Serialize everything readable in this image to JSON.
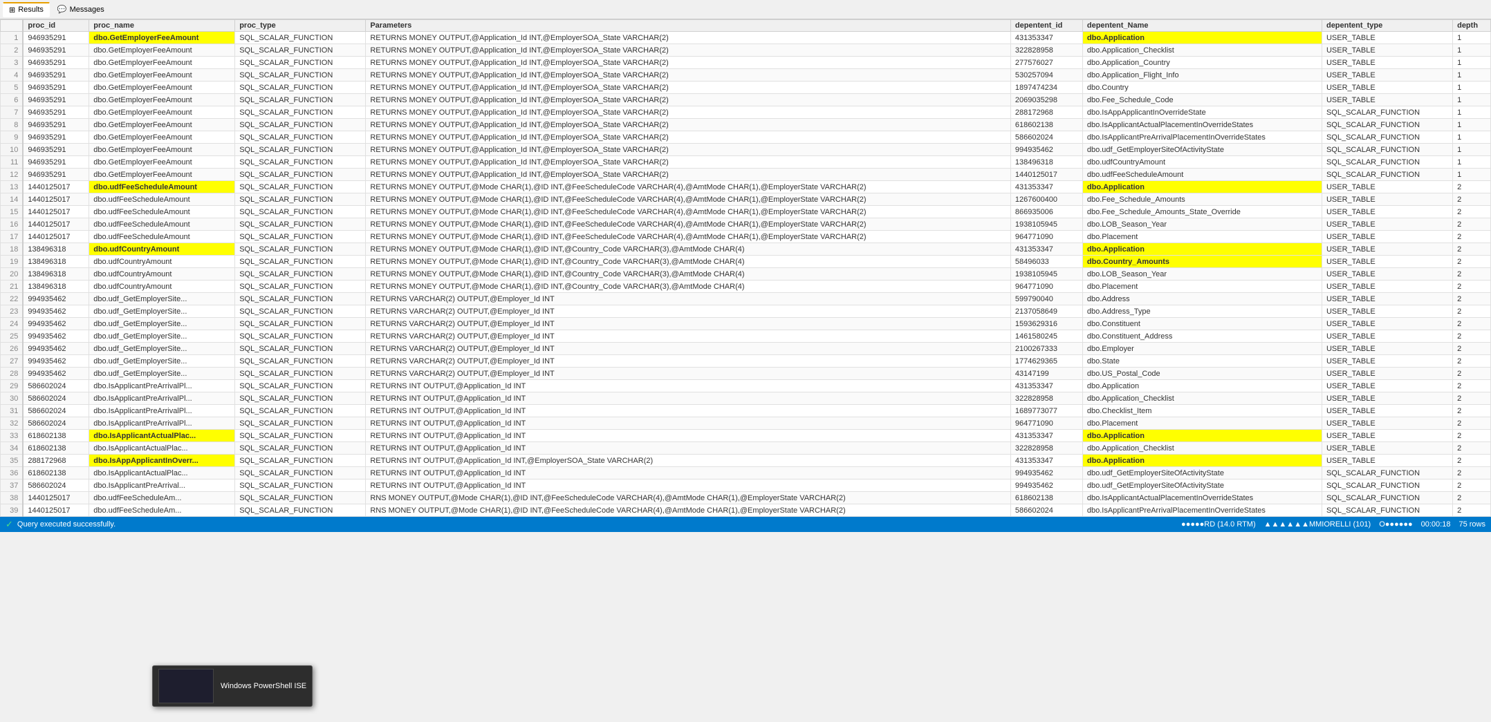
{
  "toolbar": {
    "results_label": "Results",
    "messages_label": "Messages"
  },
  "columns": [
    {
      "id": "rownum",
      "label": ""
    },
    {
      "id": "proc_id",
      "label": "proc_id"
    },
    {
      "id": "proc_name",
      "label": "proc_name"
    },
    {
      "id": "proc_type",
      "label": "proc_type"
    },
    {
      "id": "parameters",
      "label": "Parameters"
    },
    {
      "id": "depentent_id",
      "label": "depentent_id"
    },
    {
      "id": "depentent_Name",
      "label": "depentent_Name"
    },
    {
      "id": "depentent_type",
      "label": "depentent_type"
    },
    {
      "id": "depth",
      "label": "depth"
    }
  ],
  "rows": [
    {
      "rownum": 1,
      "proc_id": "946935291",
      "proc_name": "dbo.GetEmployerFeeAmount",
      "proc_type": "SQL_SCALAR_FUNCTION",
      "parameters": "RETURNS MONEY OUTPUT,@Application_Id INT,@EmployerSOA_State VARCHAR(2)",
      "depentent_id": "431353347",
      "depentent_Name": "dbo.Application",
      "depentent_type": "USER_TABLE",
      "depth": "1",
      "hl_proc": true,
      "hl_dep": true
    },
    {
      "rownum": 2,
      "proc_id": "946935291",
      "proc_name": "dbo.GetEmployerFeeAmount",
      "proc_type": "SQL_SCALAR_FUNCTION",
      "parameters": "RETURNS MONEY OUTPUT,@Application_Id INT,@EmployerSOA_State VARCHAR(2)",
      "depentent_id": "322828958",
      "depentent_Name": "dbo.Application_Checklist",
      "depentent_type": "USER_TABLE",
      "depth": "1"
    },
    {
      "rownum": 3,
      "proc_id": "946935291",
      "proc_name": "dbo.GetEmployerFeeAmount",
      "proc_type": "SQL_SCALAR_FUNCTION",
      "parameters": "RETURNS MONEY OUTPUT,@Application_Id INT,@EmployerSOA_State VARCHAR(2)",
      "depentent_id": "277576027",
      "depentent_Name": "dbo.Application_Country",
      "depentent_type": "USER_TABLE",
      "depth": "1"
    },
    {
      "rownum": 4,
      "proc_id": "946935291",
      "proc_name": "dbo.GetEmployerFeeAmount",
      "proc_type": "SQL_SCALAR_FUNCTION",
      "parameters": "RETURNS MONEY OUTPUT,@Application_Id INT,@EmployerSOA_State VARCHAR(2)",
      "depentent_id": "530257094",
      "depentent_Name": "dbo.Application_Flight_Info",
      "depentent_type": "USER_TABLE",
      "depth": "1"
    },
    {
      "rownum": 5,
      "proc_id": "946935291",
      "proc_name": "dbo.GetEmployerFeeAmount",
      "proc_type": "SQL_SCALAR_FUNCTION",
      "parameters": "RETURNS MONEY OUTPUT,@Application_Id INT,@EmployerSOA_State VARCHAR(2)",
      "depentent_id": "1897474234",
      "depentent_Name": "dbo.Country",
      "depentent_type": "USER_TABLE",
      "depth": "1"
    },
    {
      "rownum": 6,
      "proc_id": "946935291",
      "proc_name": "dbo.GetEmployerFeeAmount",
      "proc_type": "SQL_SCALAR_FUNCTION",
      "parameters": "RETURNS MONEY OUTPUT,@Application_Id INT,@EmployerSOA_State VARCHAR(2)",
      "depentent_id": "2069035298",
      "depentent_Name": "dbo.Fee_Schedule_Code",
      "depentent_type": "USER_TABLE",
      "depth": "1"
    },
    {
      "rownum": 7,
      "proc_id": "946935291",
      "proc_name": "dbo.GetEmployerFeeAmount",
      "proc_type": "SQL_SCALAR_FUNCTION",
      "parameters": "RETURNS MONEY OUTPUT,@Application_Id INT,@EmployerSOA_State VARCHAR(2)",
      "depentent_id": "288172968",
      "depentent_Name": "dbo.IsAppApplicantInOverrideState",
      "depentent_type": "SQL_SCALAR_FUNCTION",
      "depth": "1"
    },
    {
      "rownum": 8,
      "proc_id": "946935291",
      "proc_name": "dbo.GetEmployerFeeAmount",
      "proc_type": "SQL_SCALAR_FUNCTION",
      "parameters": "RETURNS MONEY OUTPUT,@Application_Id INT,@EmployerSOA_State VARCHAR(2)",
      "depentent_id": "618602138",
      "depentent_Name": "dbo.IsApplicantActualPlacementInOverrideStates",
      "depentent_type": "SQL_SCALAR_FUNCTION",
      "depth": "1"
    },
    {
      "rownum": 9,
      "proc_id": "946935291",
      "proc_name": "dbo.GetEmployerFeeAmount",
      "proc_type": "SQL_SCALAR_FUNCTION",
      "parameters": "RETURNS MONEY OUTPUT,@Application_Id INT,@EmployerSOA_State VARCHAR(2)",
      "depentent_id": "586602024",
      "depentent_Name": "dbo.IsApplicantPreArrivalPlacementInOverrideStates",
      "depentent_type": "SQL_SCALAR_FUNCTION",
      "depth": "1"
    },
    {
      "rownum": 10,
      "proc_id": "946935291",
      "proc_name": "dbo.GetEmployerFeeAmount",
      "proc_type": "SQL_SCALAR_FUNCTION",
      "parameters": "RETURNS MONEY OUTPUT,@Application_Id INT,@EmployerSOA_State VARCHAR(2)",
      "depentent_id": "994935462",
      "depentent_Name": "dbo.udf_GetEmployerSiteOfActivityState",
      "depentent_type": "SQL_SCALAR_FUNCTION",
      "depth": "1"
    },
    {
      "rownum": 11,
      "proc_id": "946935291",
      "proc_name": "dbo.GetEmployerFeeAmount",
      "proc_type": "SQL_SCALAR_FUNCTION",
      "parameters": "RETURNS MONEY OUTPUT,@Application_Id INT,@EmployerSOA_State VARCHAR(2)",
      "depentent_id": "138496318",
      "depentent_Name": "dbo.udfCountryAmount",
      "depentent_type": "SQL_SCALAR_FUNCTION",
      "depth": "1"
    },
    {
      "rownum": 12,
      "proc_id": "946935291",
      "proc_name": "dbo.GetEmployerFeeAmount",
      "proc_type": "SQL_SCALAR_FUNCTION",
      "parameters": "RETURNS MONEY OUTPUT,@Application_Id INT,@EmployerSOA_State VARCHAR(2)",
      "depentent_id": "1440125017",
      "depentent_Name": "dbo.udfFeeScheduleAmount",
      "depentent_type": "SQL_SCALAR_FUNCTION",
      "depth": "1"
    },
    {
      "rownum": 13,
      "proc_id": "1440125017",
      "proc_name": "dbo.udfFeeScheduleAmount",
      "proc_type": "SQL_SCALAR_FUNCTION",
      "parameters": "RETURNS MONEY OUTPUT,@Mode CHAR(1),@ID INT,@FeeScheduleCode VARCHAR(4),@AmtMode CHAR(1),@EmployerState VARCHAR(2)",
      "depentent_id": "431353347",
      "depentent_Name": "dbo.Application",
      "depentent_type": "USER_TABLE",
      "depth": "2",
      "hl_proc": true,
      "hl_dep": true
    },
    {
      "rownum": 14,
      "proc_id": "1440125017",
      "proc_name": "dbo.udfFeeScheduleAmount",
      "proc_type": "SQL_SCALAR_FUNCTION",
      "parameters": "RETURNS MONEY OUTPUT,@Mode CHAR(1),@ID INT,@FeeScheduleCode VARCHAR(4),@AmtMode CHAR(1),@EmployerState VARCHAR(2)",
      "depentent_id": "1267600400",
      "depentent_Name": "dbo.Fee_Schedule_Amounts",
      "depentent_type": "USER_TABLE",
      "depth": "2"
    },
    {
      "rownum": 15,
      "proc_id": "1440125017",
      "proc_name": "dbo.udfFeeScheduleAmount",
      "proc_type": "SQL_SCALAR_FUNCTION",
      "parameters": "RETURNS MONEY OUTPUT,@Mode CHAR(1),@ID INT,@FeeScheduleCode VARCHAR(4),@AmtMode CHAR(1),@EmployerState VARCHAR(2)",
      "depentent_id": "866935006",
      "depentent_Name": "dbo.Fee_Schedule_Amounts_State_Override",
      "depentent_type": "USER_TABLE",
      "depth": "2"
    },
    {
      "rownum": 16,
      "proc_id": "1440125017",
      "proc_name": "dbo.udfFeeScheduleAmount",
      "proc_type": "SQL_SCALAR_FUNCTION",
      "parameters": "RETURNS MONEY OUTPUT,@Mode CHAR(1),@ID INT,@FeeScheduleCode VARCHAR(4),@AmtMode CHAR(1),@EmployerState VARCHAR(2)",
      "depentent_id": "1938105945",
      "depentent_Name": "dbo.LOB_Season_Year",
      "depentent_type": "USER_TABLE",
      "depth": "2"
    },
    {
      "rownum": 17,
      "proc_id": "1440125017",
      "proc_name": "dbo.udfFeeScheduleAmount",
      "proc_type": "SQL_SCALAR_FUNCTION",
      "parameters": "RETURNS MONEY OUTPUT,@Mode CHAR(1),@ID INT,@FeeScheduleCode VARCHAR(4),@AmtMode CHAR(1),@EmployerState VARCHAR(2)",
      "depentent_id": "964771090",
      "depentent_Name": "dbo.Placement",
      "depentent_type": "USER_TABLE",
      "depth": "2"
    },
    {
      "rownum": 18,
      "proc_id": "138496318",
      "proc_name": "dbo.udfCountryAmount",
      "proc_type": "SQL_SCALAR_FUNCTION",
      "parameters": "RETURNS MONEY OUTPUT,@Mode CHAR(1),@ID INT,@Country_Code VARCHAR(3),@AmtMode CHAR(4)",
      "depentent_id": "431353347",
      "depentent_Name": "dbo.Application",
      "depentent_type": "USER_TABLE",
      "depth": "2",
      "hl_proc": true,
      "hl_dep": true
    },
    {
      "rownum": 19,
      "proc_id": "138496318",
      "proc_name": "dbo.udfCountryAmount",
      "proc_type": "SQL_SCALAR_FUNCTION",
      "parameters": "RETURNS MONEY OUTPUT,@Mode CHAR(1),@ID INT,@Country_Code VARCHAR(3),@AmtMode CHAR(4)",
      "depentent_id": "58496033",
      "depentent_Name": "dbo.Country_Amounts",
      "depentent_type": "USER_TABLE",
      "depth": "2",
      "hl_dep": true
    },
    {
      "rownum": 20,
      "proc_id": "138496318",
      "proc_name": "dbo.udfCountryAmount",
      "proc_type": "SQL_SCALAR_FUNCTION",
      "parameters": "RETURNS MONEY OUTPUT,@Mode CHAR(1),@ID INT,@Country_Code VARCHAR(3),@AmtMode CHAR(4)",
      "depentent_id": "1938105945",
      "depentent_Name": "dbo.LOB_Season_Year",
      "depentent_type": "USER_TABLE",
      "depth": "2"
    },
    {
      "rownum": 21,
      "proc_id": "138496318",
      "proc_name": "dbo.udfCountryAmount",
      "proc_type": "SQL_SCALAR_FUNCTION",
      "parameters": "RETURNS MONEY OUTPUT,@Mode CHAR(1),@ID INT,@Country_Code VARCHAR(3),@AmtMode CHAR(4)",
      "depentent_id": "964771090",
      "depentent_Name": "dbo.Placement",
      "depentent_type": "USER_TABLE",
      "depth": "2"
    },
    {
      "rownum": 22,
      "proc_id": "994935462",
      "proc_name": "dbo.udf_GetEmployerSite...",
      "proc_type": "SQL_SCALAR_FUNCTION",
      "parameters": "RETURNS VARCHAR(2) OUTPUT,@Employer_Id INT",
      "depentent_id": "599790040",
      "depentent_Name": "dbo.Address",
      "depentent_type": "USER_TABLE",
      "depth": "2"
    },
    {
      "rownum": 23,
      "proc_id": "994935462",
      "proc_name": "dbo.udf_GetEmployerSite...",
      "proc_type": "SQL_SCALAR_FUNCTION",
      "parameters": "RETURNS VARCHAR(2) OUTPUT,@Employer_Id INT",
      "depentent_id": "2137058649",
      "depentent_Name": "dbo.Address_Type",
      "depentent_type": "USER_TABLE",
      "depth": "2"
    },
    {
      "rownum": 24,
      "proc_id": "994935462",
      "proc_name": "dbo.udf_GetEmployerSite...",
      "proc_type": "SQL_SCALAR_FUNCTION",
      "parameters": "RETURNS VARCHAR(2) OUTPUT,@Employer_Id INT",
      "depentent_id": "1593629316",
      "depentent_Name": "dbo.Constituent",
      "depentent_type": "USER_TABLE",
      "depth": "2"
    },
    {
      "rownum": 25,
      "proc_id": "994935462",
      "proc_name": "dbo.udf_GetEmployerSite...",
      "proc_type": "SQL_SCALAR_FUNCTION",
      "parameters": "RETURNS VARCHAR(2) OUTPUT,@Employer_Id INT",
      "depentent_id": "1461580245",
      "depentent_Name": "dbo.Constituent_Address",
      "depentent_type": "USER_TABLE",
      "depth": "2"
    },
    {
      "rownum": 26,
      "proc_id": "994935462",
      "proc_name": "dbo.udf_GetEmployerSite...",
      "proc_type": "SQL_SCALAR_FUNCTION",
      "parameters": "RETURNS VARCHAR(2) OUTPUT,@Employer_Id INT",
      "depentent_id": "2100267333",
      "depentent_Name": "dbo.Employer",
      "depentent_type": "USER_TABLE",
      "depth": "2"
    },
    {
      "rownum": 27,
      "proc_id": "994935462",
      "proc_name": "dbo.udf_GetEmployerSite...",
      "proc_type": "SQL_SCALAR_FUNCTION",
      "parameters": "RETURNS VARCHAR(2) OUTPUT,@Employer_Id INT",
      "depentent_id": "1774629365",
      "depentent_Name": "dbo.State",
      "depentent_type": "USER_TABLE",
      "depth": "2"
    },
    {
      "rownum": 28,
      "proc_id": "994935462",
      "proc_name": "dbo.udf_GetEmployerSite...",
      "proc_type": "SQL_SCALAR_FUNCTION",
      "parameters": "RETURNS VARCHAR(2) OUTPUT,@Employer_Id INT",
      "depentent_id": "43147199",
      "depentent_Name": "dbo.US_Postal_Code",
      "depentent_type": "USER_TABLE",
      "depth": "2"
    },
    {
      "rownum": 29,
      "proc_id": "586602024",
      "proc_name": "dbo.IsApplicantPreArrivalPl...",
      "proc_type": "SQL_SCALAR_FUNCTION",
      "parameters": "RETURNS INT OUTPUT,@Application_Id INT",
      "depentent_id": "431353347",
      "depentent_Name": "dbo.Application",
      "depentent_type": "USER_TABLE",
      "depth": "2"
    },
    {
      "rownum": 30,
      "proc_id": "586602024",
      "proc_name": "dbo.IsApplicantPreArrivalPl...",
      "proc_type": "SQL_SCALAR_FUNCTION",
      "parameters": "RETURNS INT OUTPUT,@Application_Id INT",
      "depentent_id": "322828958",
      "depentent_Name": "dbo.Application_Checklist",
      "depentent_type": "USER_TABLE",
      "depth": "2"
    },
    {
      "rownum": 31,
      "proc_id": "586602024",
      "proc_name": "dbo.IsApplicantPreArrivalPl...",
      "proc_type": "SQL_SCALAR_FUNCTION",
      "parameters": "RETURNS INT OUTPUT,@Application_Id INT",
      "depentent_id": "1689773077",
      "depentent_Name": "dbo.Checklist_Item",
      "depentent_type": "USER_TABLE",
      "depth": "2"
    },
    {
      "rownum": 32,
      "proc_id": "586602024",
      "proc_name": "dbo.IsApplicantPreArrivalPl...",
      "proc_type": "SQL_SCALAR_FUNCTION",
      "parameters": "RETURNS INT OUTPUT,@Application_Id INT",
      "depentent_id": "964771090",
      "depentent_Name": "dbo.Placement",
      "depentent_type": "USER_TABLE",
      "depth": "2"
    },
    {
      "rownum": 33,
      "proc_id": "618602138",
      "proc_name": "dbo.IsApplicantActualPlac...",
      "proc_type": "SQL_SCALAR_FUNCTION",
      "parameters": "RETURNS INT OUTPUT,@Application_Id INT",
      "depentent_id": "431353347",
      "depentent_Name": "dbo.Application",
      "depentent_type": "USER_TABLE",
      "depth": "2",
      "hl_proc": true,
      "hl_dep": true
    },
    {
      "rownum": 34,
      "proc_id": "618602138",
      "proc_name": "dbo.IsApplicantActualPlac...",
      "proc_type": "SQL_SCALAR_FUNCTION",
      "parameters": "RETURNS INT OUTPUT,@Application_Id INT",
      "depentent_id": "322828958",
      "depentent_Name": "dbo.Application_Checklist",
      "depentent_type": "USER_TABLE",
      "depth": "2"
    },
    {
      "rownum": 35,
      "proc_id": "288172968",
      "proc_name": "dbo.IsAppApplicantInOverr...",
      "proc_type": "SQL_SCALAR_FUNCTION",
      "parameters": "RETURNS INT OUTPUT,@Application_Id INT,@EmployerSOA_State VARCHAR(2)",
      "depentent_id": "431353347",
      "depentent_Name": "dbo.Application",
      "depentent_type": "USER_TABLE",
      "depth": "2",
      "hl_proc": true,
      "hl_dep": true
    },
    {
      "rownum": 36,
      "proc_id": "618602138",
      "proc_name": "dbo.IsApplicantActualPlac...",
      "proc_type": "SQL_SCALAR_FUNCTION",
      "parameters": "RETURNS INT OUTPUT,@Application_Id INT",
      "depentent_id": "994935462",
      "depentent_Name": "dbo.udf_GetEmployerSiteOfActivityState",
      "depentent_type": "SQL_SCALAR_FUNCTION",
      "depth": "2"
    },
    {
      "rownum": 37,
      "proc_id": "586602024",
      "proc_name": "dbo.IsApplicantPreArrival...",
      "proc_type": "SQL_SCALAR_FUNCTION",
      "parameters": "RETURNS INT OUTPUT,@Application_Id INT",
      "depentent_id": "994935462",
      "depentent_Name": "dbo.udf_GetEmployerSiteOfActivityState",
      "depentent_type": "SQL_SCALAR_FUNCTION",
      "depth": "2"
    },
    {
      "rownum": 38,
      "proc_id": "1440125017",
      "proc_name": "dbo.udfFeeScheduleAm...",
      "proc_type": "SQL_SCALAR_FUNCTION",
      "parameters": "RNS MONEY OUTPUT,@Mode CHAR(1),@ID INT,@FeeScheduleCode VARCHAR(4),@AmtMode CHAR(1),@EmployerState VARCHAR(2)",
      "depentent_id": "618602138",
      "depentent_Name": "dbo.IsApplicantActualPlacementInOverrideStates",
      "depentent_type": "SQL_SCALAR_FUNCTION",
      "depth": "2"
    },
    {
      "rownum": 39,
      "proc_id": "1440125017",
      "proc_name": "dbo.udfFeeScheduleAm...",
      "proc_type": "SQL_SCALAR_FUNCTION",
      "parameters": "RNS MONEY OUTPUT,@Mode CHAR(1),@ID INT,@FeeScheduleCode VARCHAR(4),@AmtMode CHAR(1),@EmployerState VARCHAR(2)",
      "depentent_id": "586602024",
      "depentent_Name": "dbo.IsApplicantPreArrivalPlacementInOverrideStates",
      "depentent_type": "SQL_SCALAR_FUNCTION",
      "depth": "2"
    }
  ],
  "status": {
    "success_text": "Query executed successfully.",
    "server_info": "●●●●●RD (14.0 RTM)",
    "user_info": "▲▲▲▲▲▲MMIORELLI (101)",
    "db_info": "O●●●●●●",
    "time_info": "00:00:18",
    "rows_info": "75 rows"
  },
  "powershell": {
    "title": "Windows PowerShell ISE"
  }
}
